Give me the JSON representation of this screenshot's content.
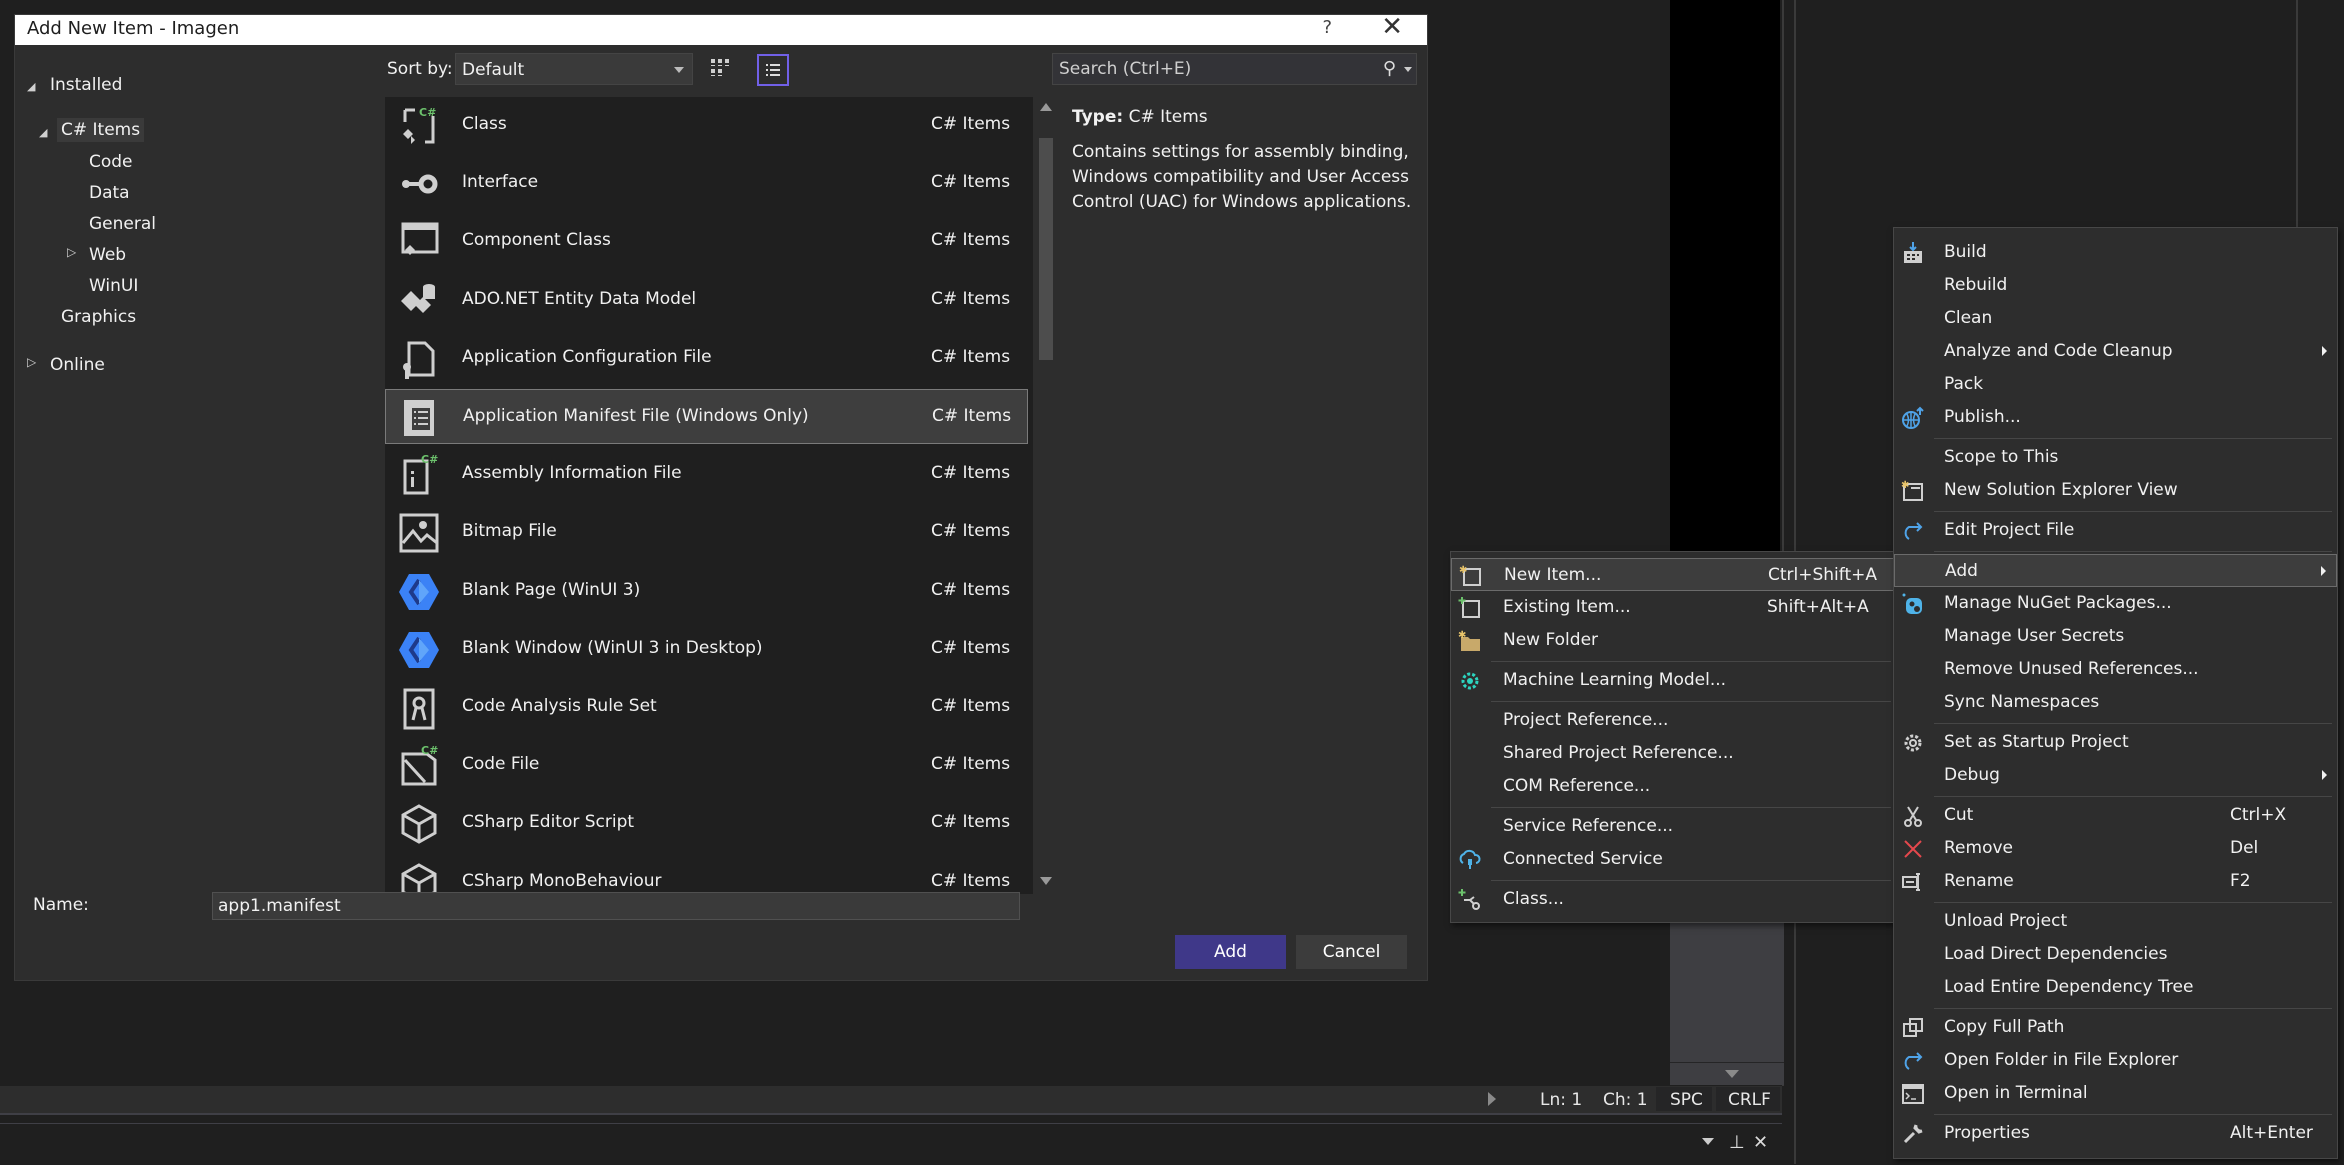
{
  "dialog": {
    "title": "Add New Item - Imagen",
    "help_label": "?",
    "close_label": "✕",
    "tree": {
      "installed": "Installed",
      "csharp_items": "C# Items",
      "children": [
        "Code",
        "Data",
        "General",
        "Web",
        "WinUI"
      ],
      "graphics": "Graphics",
      "online": "Online"
    },
    "sort_by_label": "Sort by:",
    "sort_by_value": "Default",
    "search_placeholder": "Search (Ctrl+E)",
    "items": [
      {
        "name": "Class",
        "type": "C# Items",
        "icon": "class-icon"
      },
      {
        "name": "Interface",
        "type": "C# Items",
        "icon": "interface-icon"
      },
      {
        "name": "Component Class",
        "type": "C# Items",
        "icon": "component-class-icon"
      },
      {
        "name": "ADO.NET Entity Data Model",
        "type": "C# Items",
        "icon": "entity-data-model-icon"
      },
      {
        "name": "Application Configuration File",
        "type": "C# Items",
        "icon": "config-file-icon"
      },
      {
        "name": "Application Manifest File (Windows Only)",
        "type": "C# Items",
        "icon": "manifest-icon",
        "selected": true
      },
      {
        "name": "Assembly Information File",
        "type": "C# Items",
        "icon": "assembly-info-icon"
      },
      {
        "name": "Bitmap File",
        "type": "C# Items",
        "icon": "bitmap-icon"
      },
      {
        "name": "Blank Page (WinUI 3)",
        "type": "C# Items",
        "icon": "winui-icon"
      },
      {
        "name": "Blank Window (WinUI 3 in Desktop)",
        "type": "C# Items",
        "icon": "winui-icon"
      },
      {
        "name": "Code Analysis Rule Set",
        "type": "C# Items",
        "icon": "rule-set-icon"
      },
      {
        "name": "Code File",
        "type": "C# Items",
        "icon": "code-file-icon"
      },
      {
        "name": "CSharp Editor Script",
        "type": "C# Items",
        "icon": "unity-cube-icon"
      },
      {
        "name": "CSharp MonoBehaviour",
        "type": "C# Items",
        "icon": "unity-cube-icon"
      }
    ],
    "details": {
      "type_label": "Type:",
      "type_value": "C# Items",
      "description": "Contains settings for assembly binding, Windows compatibility and User Access Control (UAC) for Windows applications."
    },
    "name_label": "Name:",
    "name_value": "app1.manifest",
    "add_label": "Add",
    "cancel_label": "Cancel"
  },
  "add_submenu": {
    "items": [
      {
        "label": "New Item...",
        "shortcut": "Ctrl+Shift+A",
        "icon": "new-item-icon",
        "highlighted": true
      },
      {
        "label": "Existing Item...",
        "shortcut": "Shift+Alt+A",
        "icon": "existing-item-icon"
      },
      {
        "label": "New Folder",
        "shortcut": "",
        "icon": "new-folder-icon"
      },
      {
        "separator": true
      },
      {
        "label": "Machine Learning Model...",
        "shortcut": "",
        "icon": "ml-model-icon"
      },
      {
        "separator": true
      },
      {
        "label": "Project Reference...",
        "shortcut": ""
      },
      {
        "label": "Shared Project Reference...",
        "shortcut": ""
      },
      {
        "label": "COM Reference...",
        "shortcut": ""
      },
      {
        "separator": true
      },
      {
        "label": "Service Reference...",
        "shortcut": ""
      },
      {
        "label": "Connected Service",
        "shortcut": "",
        "icon": "connected-service-icon"
      },
      {
        "separator": true
      },
      {
        "label": "Class...",
        "shortcut": "",
        "icon": "add-class-icon"
      }
    ]
  },
  "context_menu": {
    "items": [
      {
        "label": "Build",
        "icon": "build-icon"
      },
      {
        "label": "Rebuild"
      },
      {
        "label": "Clean"
      },
      {
        "label": "Analyze and Code Cleanup",
        "submenu": true
      },
      {
        "label": "Pack"
      },
      {
        "label": "Publish...",
        "icon": "publish-icon"
      },
      {
        "separator": true
      },
      {
        "label": "Scope to This"
      },
      {
        "label": "New Solution Explorer View",
        "icon": "new-view-icon"
      },
      {
        "separator": true
      },
      {
        "label": "Edit Project File",
        "icon": "edit-project-icon"
      },
      {
        "separator": true
      },
      {
        "label": "Add",
        "submenu": true,
        "highlighted": true
      },
      {
        "label": "Manage NuGet Packages...",
        "icon": "nuget-icon"
      },
      {
        "label": "Manage User Secrets"
      },
      {
        "label": "Remove Unused References..."
      },
      {
        "label": "Sync Namespaces"
      },
      {
        "separator": true
      },
      {
        "label": "Set as Startup Project",
        "icon": "gear-icon"
      },
      {
        "label": "Debug",
        "submenu": true
      },
      {
        "separator": true
      },
      {
        "label": "Cut",
        "shortcut": "Ctrl+X",
        "icon": "scissors-icon"
      },
      {
        "label": "Remove",
        "shortcut": "Del",
        "icon": "remove-icon"
      },
      {
        "label": "Rename",
        "shortcut": "F2",
        "icon": "rename-icon"
      },
      {
        "separator": true
      },
      {
        "label": "Unload Project"
      },
      {
        "label": "Load Direct Dependencies"
      },
      {
        "label": "Load Entire Dependency Tree"
      },
      {
        "separator": true
      },
      {
        "label": "Copy Full Path",
        "icon": "copy-icon"
      },
      {
        "label": "Open Folder in File Explorer",
        "icon": "open-folder-icon"
      },
      {
        "label": "Open in Terminal",
        "icon": "terminal-icon"
      },
      {
        "separator": true
      },
      {
        "label": "Properties",
        "shortcut": "Alt+Enter",
        "icon": "wrench-icon"
      }
    ]
  },
  "status_bar": {
    "line": "Ln: 1",
    "char": "Ch: 1",
    "spacing": "SPC",
    "line_endings": "CRLF"
  },
  "colors": {
    "accent": "#7160e8",
    "add_button": "#3f3889",
    "csharp_green": "#6cc16c",
    "winui_blue": "#3b82f6"
  }
}
